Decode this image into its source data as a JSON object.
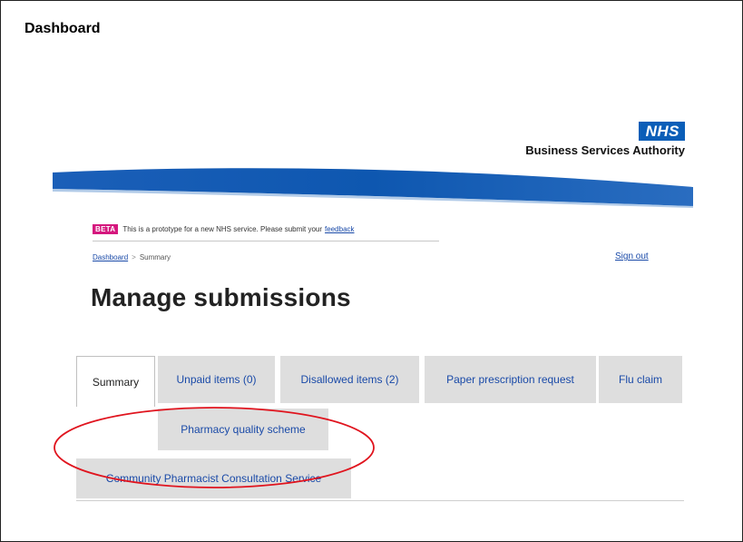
{
  "slide": {
    "title": "Dashboard"
  },
  "header": {
    "logo_text": "NHS",
    "org_name": "Business Services Authority",
    "brand_color": "#0b5eb8"
  },
  "banner": {
    "tag": "BETA",
    "message": "This is a prototype for a new NHS service. Please submit your",
    "link_label": "feedback",
    "tag_color": "#d5187e"
  },
  "breadcrumb": {
    "items": [
      "Dashboard",
      "Summary"
    ],
    "separator": ">"
  },
  "account": {
    "sign_out_label": "Sign out"
  },
  "main": {
    "heading": "Manage submissions",
    "tabs": [
      {
        "label": "Summary",
        "active": true
      },
      {
        "label": "Unpaid items (0)",
        "active": false
      },
      {
        "label": "Disallowed items (2)",
        "active": false
      },
      {
        "label": "Paper prescription request",
        "active": false
      },
      {
        "label": "Flu claim",
        "active": false
      },
      {
        "label": "Pharmacy quality scheme",
        "active": false
      },
      {
        "label": "Community Pharmacist Consultation Service",
        "active": false
      }
    ]
  },
  "annotation": {
    "color": "#e0141e",
    "shape": "ellipse"
  }
}
